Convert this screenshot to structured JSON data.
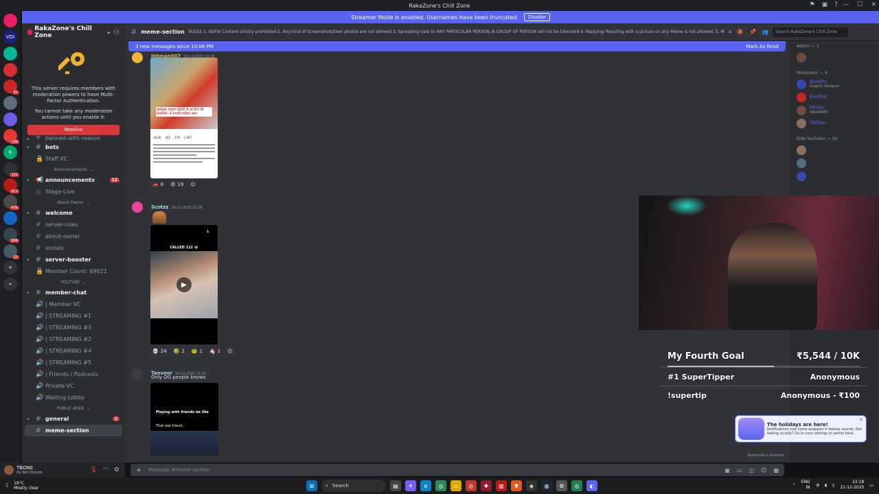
{
  "window": {
    "title": "RakaZone's Chill Zone"
  },
  "streamer_banner": {
    "text": "Streamer Mode is enabled. Usernames have been truncated.",
    "button": "Disable"
  },
  "server_list": [
    {
      "label": "",
      "color": "#e91e63",
      "badge": ""
    },
    {
      "label": "VDI",
      "color": "#1a237e",
      "badge": ""
    },
    {
      "label": "",
      "color": "#00b894",
      "badge": ""
    },
    {
      "label": "",
      "color": "#d32f2f",
      "badge": ""
    },
    {
      "label": "",
      "color": "#c62828",
      "badge": "87"
    },
    {
      "label": "",
      "color": "#5d6d7e",
      "badge": ""
    },
    {
      "label": "",
      "color": "#6c5ce7",
      "badge": ""
    },
    {
      "label": "",
      "color": "#e53935",
      "badge": "199"
    },
    {
      "label": "K",
      "color": "#00a86b",
      "badge": ""
    },
    {
      "label": "",
      "color": "#2d3436",
      "badge": "131"
    },
    {
      "label": "",
      "color": "#b71c1c",
      "badge": "612"
    },
    {
      "label": "",
      "color": "#4a4a4a",
      "badge": "476"
    },
    {
      "label": "",
      "color": "#1565c0",
      "badge": ""
    },
    {
      "label": "",
      "color": "#37474f",
      "badge": "906"
    },
    {
      "label": "",
      "color": "#455a64",
      "badge": "13"
    },
    {
      "label": "+",
      "color": "#313338",
      "badge": ""
    },
    {
      "label": "⌖",
      "color": "#313338",
      "badge": ""
    }
  ],
  "sidebar": {
    "server_name": "RakaZone's Chill Zone",
    "mfa_notice": {
      "text1": "This server requires members with moderation powers to have Multi-Factor Authentication.",
      "text2": "You cannot take any moderation actions until you enable it.",
      "button": "Resolve"
    },
    "channels": [
      {
        "label": "banned-with-reason",
        "kind": "text",
        "bold": false,
        "arrow": "▸",
        "badge": "",
        "cut": true
      },
      {
        "label": "bots",
        "kind": "text",
        "bold": true,
        "arrow": "▸",
        "badge": ""
      },
      {
        "label": "Staff VC",
        "kind": "lock",
        "bold": false,
        "arrow": "",
        "badge": ""
      },
      {
        "cat": "Announcements"
      },
      {
        "label": "announcements",
        "kind": "speaker",
        "bold": true,
        "arrow": "▸",
        "badge": "12"
      },
      {
        "label": "Stage-Live",
        "kind": "stage",
        "bold": false,
        "arrow": "",
        "badge": ""
      },
      {
        "cat": "About Owner"
      },
      {
        "label": "welcome",
        "kind": "text",
        "bold": true,
        "arrow": "▸",
        "badge": ""
      },
      {
        "label": "server-rules",
        "kind": "text",
        "bold": false,
        "arrow": "",
        "badge": ""
      },
      {
        "label": "about-owner",
        "kind": "text",
        "bold": false,
        "arrow": "",
        "badge": ""
      },
      {
        "label": "socials",
        "kind": "text",
        "bold": false,
        "arrow": "",
        "badge": ""
      },
      {
        "label": "server-booster",
        "kind": "text",
        "bold": true,
        "arrow": "▸",
        "badge": ""
      },
      {
        "label": "Member Count: 69021",
        "kind": "lock",
        "bold": false,
        "arrow": "",
        "badge": ""
      },
      {
        "cat": "YOUTUBE"
      },
      {
        "label": "member-chat",
        "kind": "text",
        "bold": true,
        "arrow": "▸",
        "badge": ""
      },
      {
        "label": "| Member VC",
        "kind": "voice",
        "bold": false,
        "arrow": "",
        "badge": ""
      },
      {
        "label": "| STREAMING #1",
        "kind": "voice",
        "bold": false,
        "arrow": "",
        "badge": ""
      },
      {
        "label": "| STREAMING #3",
        "kind": "voice",
        "bold": false,
        "arrow": "",
        "badge": ""
      },
      {
        "label": "| STREAMING #2",
        "kind": "voice",
        "bold": false,
        "arrow": "",
        "badge": ""
      },
      {
        "label": "| STREAMING #4",
        "kind": "voice",
        "bold": false,
        "arrow": "",
        "badge": ""
      },
      {
        "label": "| STREAMING #5",
        "kind": "voice",
        "bold": false,
        "arrow": "",
        "badge": ""
      },
      {
        "label": "| Friends / Podcasts",
        "kind": "voice",
        "bold": false,
        "arrow": "",
        "badge": ""
      },
      {
        "label": "Private VC",
        "kind": "voice",
        "bold": false,
        "arrow": "",
        "badge": ""
      },
      {
        "label": "Waiting Lobby",
        "kind": "voice",
        "bold": false,
        "arrow": "",
        "badge": ""
      },
      {
        "cat": "PUBLIC AREA"
      },
      {
        "label": "general",
        "kind": "text",
        "bold": true,
        "arrow": "▸",
        "badge": "2"
      },
      {
        "label": "meme-section",
        "kind": "text",
        "bold": true,
        "arrow": "",
        "badge": "",
        "selected": true
      }
    ],
    "user": {
      "name": "TBONE",
      "status": "Do Not Disturb"
    }
  },
  "header": {
    "channel": "meme-section",
    "topic": "RULES 1. NSFW Content strictly prohibited 2. Any kind of Screenshots/Own photos are not allowed 3. Spreading hate to ANY PARTICULAR PERSON /A GROUP OF PERSON will not be tolerated 4. Replying/ Reacting with a picture on any Meme is not allowed. 5. Me...",
    "search_placeholder": "Search RakaZone's Chill Zone"
  },
  "new_messages": {
    "text": "3 new messages since 10:06 PM",
    "action": "Mark As Read"
  },
  "messages": [
    {
      "author": "Hitman007",
      "time": "19-12-2025 10:38",
      "reactions": [
        {
          "e": "🚗",
          "n": "6"
        },
        {
          "e": "😡",
          "n": "19"
        },
        {
          "e": "☺",
          "n": ""
        }
      ]
    },
    {
      "author": "Scotzz",
      "time": "19-12-2025 11:26",
      "image_caption": "CALLED 112 😂",
      "reactions": [
        {
          "e": "💀",
          "n": "24"
        },
        {
          "e": "🤣",
          "n": "2"
        },
        {
          "e": "🐸",
          "n": "1"
        },
        {
          "e": "🦄",
          "n": "1"
        },
        {
          "e": "☺",
          "n": ""
        }
      ]
    },
    {
      "author": "Tanveer",
      "time": "19-12-2025 11:29",
      "text": "Only OG people knows",
      "image_caption": "Playing with friends be like",
      "image_sub": "That one friend :"
    }
  ],
  "post1_text": {
    "headline": "फुसफुस अनुराग द्विवेदी के घर ED की छापेमारी, 4 लग्जरी गाड़ियां जब्त",
    "likes": "18.2K",
    "comments": "267",
    "shares": "178",
    "saves": "1,587"
  },
  "composer": {
    "placeholder": "Message #meme-section"
  },
  "members": {
    "groups": [
      {
        "title": "Admin — 1",
        "items": [
          {
            "name": "",
            "sub": "",
            "color": "#5865f2"
          }
        ]
      },
      {
        "title": "Moderator — 4",
        "items": [
          {
            "name": "Bundro",
            "sub": "Graphic Designer",
            "color": "#5865f2"
          },
          {
            "name": "Exelliar",
            "sub": "",
            "color": "#5865f2"
          },
          {
            "name": "PhiXer",
            "sub": "VALORANT",
            "color": "#5865f2"
          },
          {
            "name": "TbOne",
            "sub": "",
            "color": "#5865f2"
          }
        ]
      },
      {
        "title": "Elite YouTuber — 50",
        "items": [
          {
            "name": "",
            "sub": "",
            "color": "#e91e63"
          },
          {
            "name": "",
            "sub": "",
            "color": "#e91e63"
          },
          {
            "name": "",
            "sub": "",
            "color": "#e91e63"
          }
        ]
      }
    ]
  },
  "overlay": {
    "goal_title": "My Fourth Goal",
    "goal_amount": "₹5,544 / 10K",
    "goal_progress": 0.5544,
    "tipper_label": "#1 SuperTipper",
    "tipper_name": "Anonymous",
    "cmd": "!supertip",
    "cmd_value": "Anonymous - ₹100"
  },
  "holiday": {
    "title": "The holidays are here!",
    "body": "Notifications now come wrapped in festive sounds. Not feeling so jolly? Go to your settings to switch back."
  },
  "slowmode": "Slowmode is enabled.",
  "taskbar": {
    "weather_temp": "19°C",
    "weather_desc": "Mostly clear",
    "search": "Search",
    "lang1": "ENG",
    "lang2": "IN",
    "time": "22:18",
    "date": "21-12-2025"
  }
}
